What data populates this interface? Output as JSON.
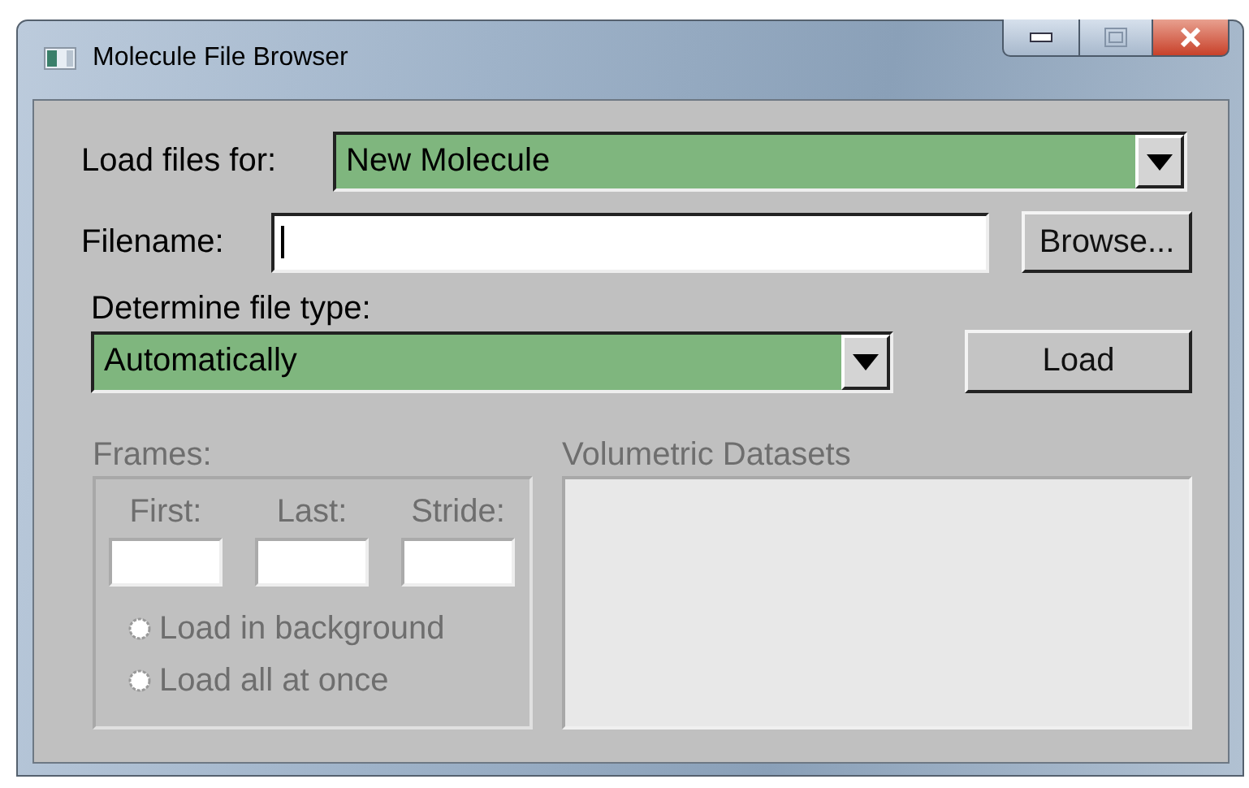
{
  "window": {
    "title": "Molecule File Browser"
  },
  "load_files_for": {
    "label": "Load files for:",
    "value": "New Molecule"
  },
  "filename": {
    "label": "Filename:",
    "focused": true,
    "button": "Browse..."
  },
  "file_type": {
    "label": "Determine file type:",
    "value": "Automatically"
  },
  "load_button": "Load",
  "frames": {
    "label": "Frames:",
    "disabled": true,
    "fields": [
      {
        "label": "First:"
      },
      {
        "label": "Last:"
      },
      {
        "label": "Stride:"
      }
    ],
    "options": [
      {
        "label": "Load in background",
        "selected": false
      },
      {
        "label": "Load all at once",
        "selected": false
      }
    ]
  },
  "volumetric": {
    "label": "Volumetric Datasets",
    "disabled": true
  }
}
